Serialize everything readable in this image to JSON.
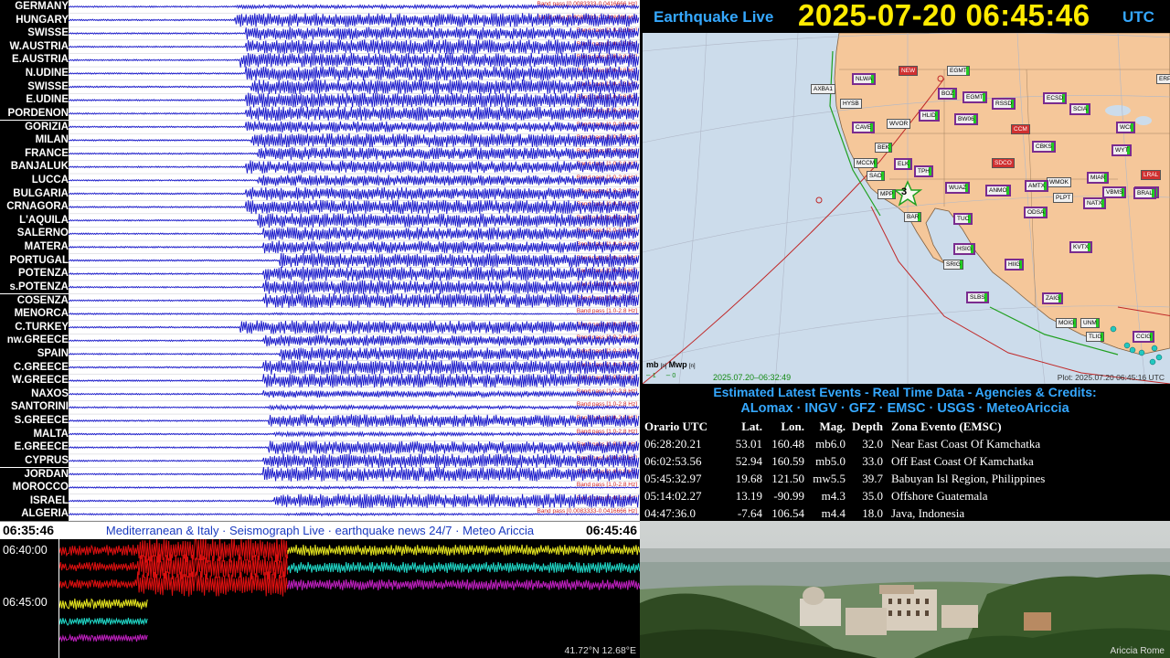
{
  "seismograph": {
    "stations": [
      {
        "name": "GERMANY",
        "band": "Band pass [0.0083333-0.0416666 Hz]",
        "onset": 0.29,
        "amp": 0.25,
        "end": 1.0
      },
      {
        "name": "HUNGARY",
        "band": "Band pass [0.0083333-0.0416666 Hz]",
        "onset": 0.29,
        "amp": 0.95,
        "end": 1.0
      },
      {
        "name": "SWISSE",
        "band": "Band pass [1.0-2.8 Hz]",
        "onset": 0.31,
        "amp": 0.9,
        "end": 0.9
      },
      {
        "name": "W.AUSTRIA",
        "band": "Band pass [1.0-2.8 Hz]",
        "onset": 0.31,
        "amp": 1.0,
        "end": 1.0
      },
      {
        "name": "E.AUSTRIA",
        "band": "Band pass [1.0-2.8 Hz]",
        "onset": 0.3,
        "amp": 1.0,
        "end": 1.0
      },
      {
        "name": "N.UDINE",
        "band": "Band pass [1.0-2.8 Hz]",
        "onset": 0.31,
        "amp": 1.0,
        "end": 1.0
      },
      {
        "name": "SWISSE",
        "band": "Band pass [1.0-2.8 Hz]",
        "onset": 0.32,
        "amp": 1.0,
        "end": 1.0
      },
      {
        "name": "E.UDINE",
        "band": "Band pass [1.0-2.8 Hz]",
        "onset": 0.31,
        "amp": 1.0,
        "end": 1.0
      },
      {
        "name": "PORDENON",
        "band": "Band pass [1.0-2.8 Hz]",
        "onset": 0.31,
        "amp": 1.0,
        "end": 0.85
      },
      {
        "name": "GORIZIA",
        "band": "Band pass [1.0-2.8 Hz]",
        "onset": 0.31,
        "amp": 0.8,
        "end": 0.8
      },
      {
        "name": "MILAN",
        "band": "Band pass [1.0-2.8 Hz]",
        "onset": 0.32,
        "amp": 1.0,
        "end": 0.9
      },
      {
        "name": "FRANCE",
        "band": "Band pass [1.0-2.8 Hz]",
        "onset": 0.33,
        "amp": 0.9,
        "end": 0.85
      },
      {
        "name": "BANJALUK",
        "band": "Band pass [1.0-2.8 Hz]",
        "onset": 0.31,
        "amp": 0.9,
        "end": 0.85
      },
      {
        "name": "LUCCA",
        "band": "Band pass [1.0-2.8 Hz]",
        "onset": 0.33,
        "amp": 0.8,
        "end": 0.8
      },
      {
        "name": "BULGARIA",
        "band": "Band pass [1.0-2.8 Hz]",
        "onset": 0.31,
        "amp": 0.9,
        "end": 0.85
      },
      {
        "name": "CRNAGORA",
        "band": "Band pass [1.0-2.8 Hz]",
        "onset": 0.31,
        "amp": 1.0,
        "end": 0.9
      },
      {
        "name": "L'AQUILA",
        "band": "Band pass [1.0-2.8 Hz]",
        "onset": 0.33,
        "amp": 1.0,
        "end": 0.9
      },
      {
        "name": "SALERNO",
        "band": "Band pass [1.0-2.8 Hz]",
        "onset": 0.34,
        "amp": 0.9,
        "end": 0.9
      },
      {
        "name": "MATERA",
        "band": "Band pass [1.0-2.8 Hz]",
        "onset": 0.34,
        "amp": 0.9,
        "end": 0.85
      },
      {
        "name": "PORTUGAL",
        "band": "Band pass [1.0-2.8 Hz]",
        "onset": 0.37,
        "amp": 1.0,
        "end": 0.9
      },
      {
        "name": "POTENZA",
        "band": "Band pass [1.0-2.8 Hz]",
        "onset": 0.34,
        "amp": 1.0,
        "end": 0.95
      },
      {
        "name": "s.POTENZA",
        "band": "Band pass [1.0-2.8 Hz]",
        "onset": 0.34,
        "amp": 1.0,
        "end": 0.9
      },
      {
        "name": "COSENZA",
        "band": "Band pass [1.0-2.8 Hz]",
        "onset": 0.34,
        "amp": 1.0,
        "end": 0.95
      },
      {
        "name": "MENORCA",
        "band": "Band pass [1.0-2.8 Hz]",
        "onset": 0.35,
        "amp": 0.15,
        "end": 0.3
      },
      {
        "name": "C.TURKEY",
        "band": "Band pass [1.0-2.8 Hz]",
        "onset": 0.3,
        "amp": 0.95,
        "end": 0.9
      },
      {
        "name": "nw.GREECE",
        "band": "Band pass [1.0-2.8 Hz]",
        "onset": 0.34,
        "amp": 0.8,
        "end": 0.85
      },
      {
        "name": "SPAIN",
        "band": "Band pass [1.0-2.8 Hz]",
        "onset": 0.37,
        "amp": 0.9,
        "end": 0.9
      },
      {
        "name": "C.GREECE",
        "band": "Band pass [1.0-2.8 Hz]",
        "onset": 0.34,
        "amp": 1.0,
        "end": 0.9
      },
      {
        "name": "W.GREECE",
        "band": "Band pass [1.0-2.8 Hz]",
        "onset": 0.34,
        "amp": 1.0,
        "end": 0.9
      },
      {
        "name": "NAXOS",
        "band": "Band pass [1.0-2.8 Hz]",
        "onset": 0.34,
        "amp": 0.5,
        "end": 0.7
      },
      {
        "name": "SANTORINI",
        "band": "Band pass [1.0-2.8 Hz]",
        "onset": 0.35,
        "amp": 0.3,
        "end": 0.6
      },
      {
        "name": "S.GREECE",
        "band": "Band pass [1.0-2.8 Hz]",
        "onset": 0.35,
        "amp": 0.9,
        "end": 0.9
      },
      {
        "name": "MALTA",
        "band": "Band pass [1.0-2.8 Hz]",
        "onset": 0.36,
        "amp": 0.3,
        "end": 0.5
      },
      {
        "name": "E.GREECE",
        "band": "Band pass [1.0-2.8 Hz]",
        "onset": 0.35,
        "amp": 0.9,
        "end": 0.9
      },
      {
        "name": "CYPRUS",
        "band": "Band pass [1.0-2.8 Hz]",
        "onset": 0.34,
        "amp": 1.0,
        "end": 0.95
      },
      {
        "name": "JORDAN",
        "band": "Band pass [1.0-2.8 Hz]",
        "onset": 0.34,
        "amp": 1.0,
        "end": 0.95
      },
      {
        "name": "MOROCCO",
        "band": "Band pass [1.0-2.8 Hz]",
        "onset": 0.36,
        "amp": 0.2,
        "end": 0.4
      },
      {
        "name": "ISRAEL",
        "band": "Band pass [1.0-2.8 Hz]",
        "onset": 0.36,
        "amp": 1.0,
        "end": 0.95
      },
      {
        "name": "ALGERIA",
        "band": "Band pass [0.0083333-0.0416666 Hz]",
        "onset": 0.38,
        "amp": 0.2,
        "end": 0.4
      }
    ],
    "trace_color": "#1212c8"
  },
  "info_bar": {
    "start_time": "06:35:46",
    "end_time": "06:45:46",
    "caption": "Mediterranean & Italy · Seismograph Live · earthquake news 24/7 · Meteo Ariccia"
  },
  "helicorder": {
    "times": [
      "06:40:00",
      "06:45:00"
    ],
    "coords": "41.72°N 12.68°E",
    "colors": [
      "#e01010",
      "#e8e820",
      "#20d8c8",
      "#c020c0"
    ]
  },
  "header": {
    "app_title": "Earthquake Live",
    "clock": "2025-07-20 06:45:46",
    "timezone": "UTC"
  },
  "map": {
    "legend_mb": "mb",
    "legend_mwp": "Mwp",
    "legend_unit": "[n]",
    "legend_vals": [
      "1",
      "0"
    ],
    "date": "2025.07.20–06:32:49",
    "plot_label": "Plot: 2025.07.20 06:45:16 UTC",
    "event_number": "3",
    "stations": [
      {
        "code": "NLWA",
        "state": "ok purple"
      },
      {
        "code": "NEW",
        "state": "bad"
      },
      {
        "code": "EGMT",
        "state": "ok"
      },
      {
        "code": "AXBA1",
        "state": "plain"
      },
      {
        "code": "BOZ",
        "state": "ok purple"
      },
      {
        "code": "EGMT",
        "state": "ok purple"
      },
      {
        "code": "HYSB",
        "state": "plain"
      },
      {
        "code": "HLID",
        "state": "ok purple"
      },
      {
        "code": "BW06",
        "state": "ok purple"
      },
      {
        "code": "RSSD",
        "state": "ok purple"
      },
      {
        "code": "ECSD",
        "state": "ok purple"
      },
      {
        "code": "SCIA",
        "state": "ok purple"
      },
      {
        "code": "CAVE",
        "state": "ok purple"
      },
      {
        "code": "WVOR",
        "state": "plain"
      },
      {
        "code": "CCM",
        "state": "bad"
      },
      {
        "code": "CBKS",
        "state": "ok purple"
      },
      {
        "code": "BEK",
        "state": "ok"
      },
      {
        "code": "MCCM",
        "state": "ok"
      },
      {
        "code": "ELK",
        "state": "ok purple"
      },
      {
        "code": "WMOK",
        "state": "plain"
      },
      {
        "code": "SAO",
        "state": "ok"
      },
      {
        "code": "TPH",
        "state": "ok purple"
      },
      {
        "code": "SDCO",
        "state": "bad"
      },
      {
        "code": "MPP",
        "state": "ok"
      },
      {
        "code": "WUAZ",
        "state": "ok purple"
      },
      {
        "code": "ANMO",
        "state": "ok purple"
      },
      {
        "code": "AMTX",
        "state": "ok purple"
      },
      {
        "code": "PLPT",
        "state": "plain"
      },
      {
        "code": "NATX",
        "state": "ok purple"
      },
      {
        "code": "VBMS",
        "state": "ok purple"
      },
      {
        "code": "DGMT",
        "state": "ok purple"
      },
      {
        "code": "TUC",
        "state": "ok purple"
      },
      {
        "code": "ODSA",
        "state": "ok purple"
      },
      {
        "code": "MIAR",
        "state": "ok purple"
      },
      {
        "code": "BAR",
        "state": "ok"
      },
      {
        "code": "HSIG",
        "state": "ok purple"
      },
      {
        "code": "KVTX",
        "state": "ok purple"
      },
      {
        "code": "SRIG",
        "state": "ok"
      },
      {
        "code": "HIIG",
        "state": "ok purple"
      },
      {
        "code": "SLBS",
        "state": "ok purple"
      },
      {
        "code": "ZAIG",
        "state": "ok purple"
      },
      {
        "code": "MOIG",
        "state": "ok"
      },
      {
        "code": "UNM",
        "state": "ok"
      },
      {
        "code": "TLIG",
        "state": "ok"
      },
      {
        "code": "CCIG",
        "state": "ok purple"
      },
      {
        "code": "WCI",
        "state": "ok purple"
      },
      {
        "code": "WYT",
        "state": "ok purple"
      },
      {
        "code": "ERPA",
        "state": "ok"
      },
      {
        "code": "BRAL",
        "state": "ok purple"
      },
      {
        "code": "LRAL",
        "state": "bad"
      }
    ]
  },
  "credits": {
    "line1": "Estimated Latest Events - Real Time Data - Agencies & Credits:",
    "line2": "ALomax · INGV · GFZ · EMSC · USGS · MeteoAriccia"
  },
  "events": {
    "headers": [
      "Orario UTC",
      "Lat.",
      "Lon.",
      "Mag.",
      "Depth",
      "Zona Evento (EMSC)"
    ],
    "rows": [
      [
        "06:28:20.21",
        "53.01",
        "160.48",
        "mb6.0",
        "32.0",
        "Near East Coast Of Kamchatka"
      ],
      [
        "06:02:53.56",
        "52.94",
        "160.59",
        "mb5.0",
        "33.0",
        "Off East Coast Of Kamchatka"
      ],
      [
        "05:45:32.97",
        "19.68",
        "121.50",
        "mw5.5",
        "39.7",
        "Babuyan Isl Region, Philippines"
      ],
      [
        "05:14:02.27",
        "13.19",
        "-90.99",
        "m4.3",
        "35.0",
        "Offshore Guatemala"
      ],
      [
        "04:47:36.0",
        "-7.64",
        "106.54",
        "m4.4",
        "18.0",
        "Java, Indonesia"
      ]
    ]
  },
  "webcam": {
    "label": "Ariccia  Rome"
  }
}
